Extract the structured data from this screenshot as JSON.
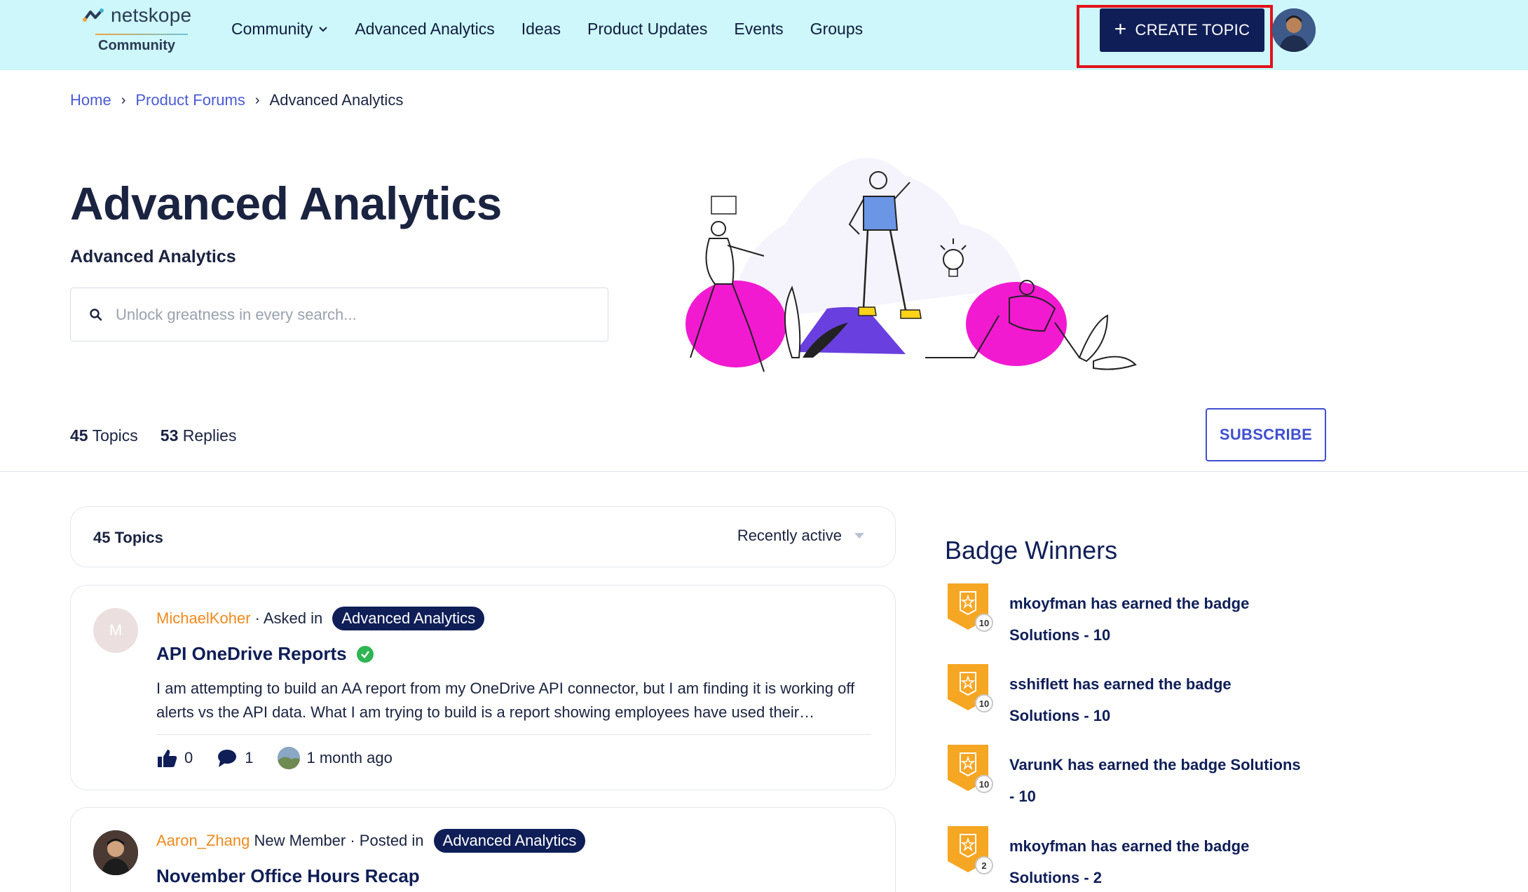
{
  "header": {
    "logo": {
      "brand": "netskope",
      "sub": "Community"
    },
    "nav": [
      {
        "label": "Community",
        "has_dropdown": true
      },
      {
        "label": "Advanced Analytics"
      },
      {
        "label": "Ideas"
      },
      {
        "label": "Product Updates"
      },
      {
        "label": "Events"
      },
      {
        "label": "Groups"
      }
    ],
    "create_label": "CREATE TOPIC"
  },
  "breadcrumb": [
    "Home",
    "Product Forums",
    "Advanced Analytics"
  ],
  "page": {
    "title": "Advanced Analytics",
    "subtitle": "Advanced Analytics",
    "search_placeholder": "Unlock greatness in every search...",
    "topics_count": "45",
    "topics_label": "Topics",
    "replies_count": "53",
    "replies_label": "Replies",
    "subscribe_label": "SUBSCRIBE"
  },
  "list": {
    "header_count": "45 Topics",
    "sort": "Recently active",
    "topics": [
      {
        "avatar_letter": "M",
        "author": "MichaelKoher",
        "role": "",
        "action": " · Asked in ",
        "category": "Advanced Analytics",
        "title": "API OneDrive Reports",
        "solved": true,
        "excerpt": "I am attempting to build an AA report from my OneDrive API connector, but I am finding it is working off alerts vs the API data. What I am trying to build is a report showing employees have used their…",
        "likes": "0",
        "replies": "1",
        "last_activity": "1 month ago"
      },
      {
        "author": "Aaron_Zhang",
        "role": " New Member",
        "action": " · Posted in ",
        "category": "Advanced Analytics",
        "title": "November Office Hours Recap"
      }
    ]
  },
  "badge_winners": {
    "title": "Badge Winners",
    "items": [
      {
        "text": "mkoyfman has earned the badge Solutions - 10",
        "level": "10"
      },
      {
        "text": "sshiflett has earned the badge Solutions - 10",
        "level": "10"
      },
      {
        "text": "VarunK has earned the badge Solutions - 10",
        "level": "10"
      },
      {
        "text": "mkoyfman has earned the badge Solutions - 2",
        "level": "2"
      }
    ]
  },
  "colors": {
    "header_bg": "#cdf7fb",
    "primary": "#0f1e57",
    "accent_link": "#4a5bd6",
    "author": "#f08a1c",
    "highlight": "#e3121b",
    "badge": "#f5a623",
    "magenta": "#f21ad1",
    "purple": "#6a3fe0"
  }
}
